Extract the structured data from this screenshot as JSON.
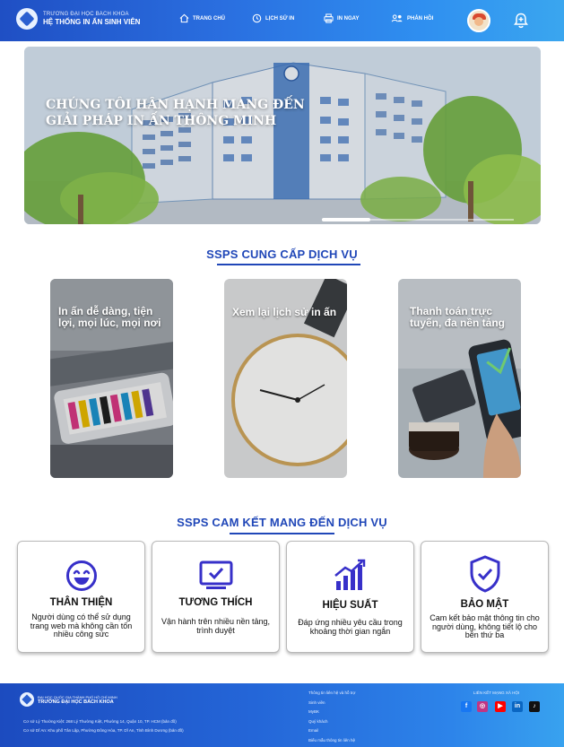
{
  "header": {
    "brand_sub": "TRƯỜNG ĐẠI HỌC BÁCH KHOA",
    "brand_main": "HỆ THỐNG IN ẤN SINH VIÊN",
    "nav": [
      {
        "label": "TRANG CHỦ",
        "icon": "home-icon"
      },
      {
        "label": "LỊCH SỬ IN",
        "icon": "history-icon"
      },
      {
        "label": "IN NGAY",
        "icon": "printer-icon"
      },
      {
        "label": "PHẢN HỒI",
        "icon": "feedback-icon"
      }
    ]
  },
  "hero": {
    "title_line1": "CHÚNG TÔI HÂN HẠNH MANG ĐẾN",
    "title_line2": "GIẢI PHÁP IN ẤN THÔNG MINH",
    "slide_position": 0.25
  },
  "services": {
    "title": "SSPS CUNG CẤP DỊCH VỤ",
    "items": [
      {
        "title": "In ấn dễ dàng, tiện lợi, mọi lúc, mọi nơi"
      },
      {
        "title": "Xem lại lịch sử in ấn"
      },
      {
        "title": "Thanh toán trực tuyến, đa nền tảng"
      }
    ]
  },
  "commitments": {
    "title": "SSPS CAM KẾT MANG ĐẾN DỊCH VỤ",
    "items": [
      {
        "title": "THÂN THIỆN",
        "desc": "Người dùng có thể sử dụng trang web mà không cần tốn nhiều công sức",
        "icon": "smile-icon"
      },
      {
        "title": "TƯƠNG THÍCH",
        "desc": "Vận hành trên nhiều nền tảng, trình duyệt",
        "icon": "monitor-check-icon"
      },
      {
        "title": "HIỆU SUẤT",
        "desc": "Đáp ứng nhiều yêu cầu trong khoảng thời gian ngắn",
        "icon": "chart-up-icon"
      },
      {
        "title": "BẢO MẬT",
        "desc": "Cam kết bảo mật thông tin cho người dùng, không tiết lộ cho bên thứ ba",
        "icon": "shield-check-icon"
      }
    ]
  },
  "footer": {
    "brand_sub": "ĐẠI HỌC QUỐC GIA THÀNH PHỐ HỒ CHÍ MINH",
    "brand_main": "TRƯỜNG ĐẠI HỌC BÁCH KHOA",
    "address1": "Cơ sở Lý Thường Kiệt: 268 Lý Thường Kiệt, Phường 14, Quận 10, TP. HCM (bản đồ)",
    "address2": "Cơ sở Dĩ An: Khu phố Tân Lập, Phường Đông Hòa, TP. Dĩ An, Tỉnh Bình Dương (bản đồ)",
    "links": [
      "Thông tin liên hệ và hỗ trợ",
      "Sinh viên",
      "MyBK",
      "Quý khách",
      "Email",
      "Biểu mẫu thông tin liên hệ"
    ],
    "social_label": "LIÊN KẾT MẠNG XÃ HỘI",
    "social": [
      {
        "name": "facebook-icon",
        "glyph": "f",
        "color": "#1877f2"
      },
      {
        "name": "instagram-icon",
        "glyph": "◎",
        "color": "#c13584"
      },
      {
        "name": "youtube-icon",
        "glyph": "▶",
        "color": "#ff0000"
      },
      {
        "name": "linkedin-icon",
        "glyph": "in",
        "color": "#0a66c2"
      },
      {
        "name": "tiktok-icon",
        "glyph": "♪",
        "color": "#111111"
      }
    ]
  }
}
